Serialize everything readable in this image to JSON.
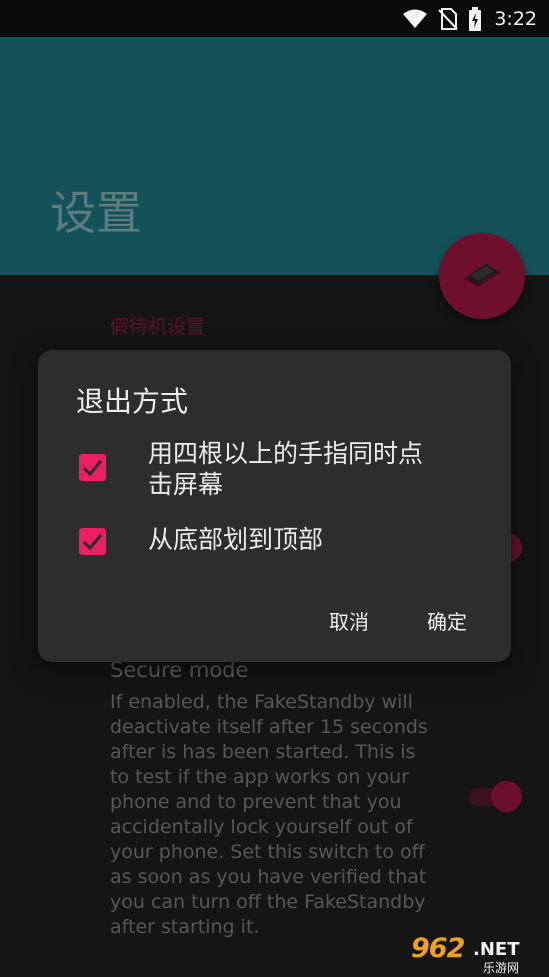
{
  "status_bar": {
    "time": "3:22",
    "icons": [
      "wifi-icon",
      "no-sim-icon",
      "battery-charging-icon"
    ]
  },
  "app_bar": {
    "title": "设置"
  },
  "fab": {
    "icon": "phone-standby-icon"
  },
  "settings": {
    "section_title": "假待机设置",
    "secure_mode": {
      "title": "Secure mode",
      "description": "If enabled, the FakeStandby will\ndeactivate itself after 15 seconds\nafter is has been started. This is\nto test if the app works on your\nphone and to prevent that you\naccidentally lock yourself out of\nyour phone. Set this switch to off\nas soon as you have verified that\nyou can turn off the FakeStandby\nafter starting it.",
      "enabled": true
    }
  },
  "dialog": {
    "title": "退出方式",
    "options": [
      {
        "label": "用四根以上的手指同时点\n击屏幕",
        "checked": true
      },
      {
        "label": "从底部划到顶部",
        "checked": true
      }
    ],
    "cancel_label": "取消",
    "confirm_label": "确定"
  },
  "watermark": {
    "brand": "962",
    "suffix": ".NET",
    "sub": "乐游网"
  },
  "colors": {
    "accent": "#e91e63",
    "app_bar": "#135257",
    "dialog_bg": "#2d2d2e"
  }
}
